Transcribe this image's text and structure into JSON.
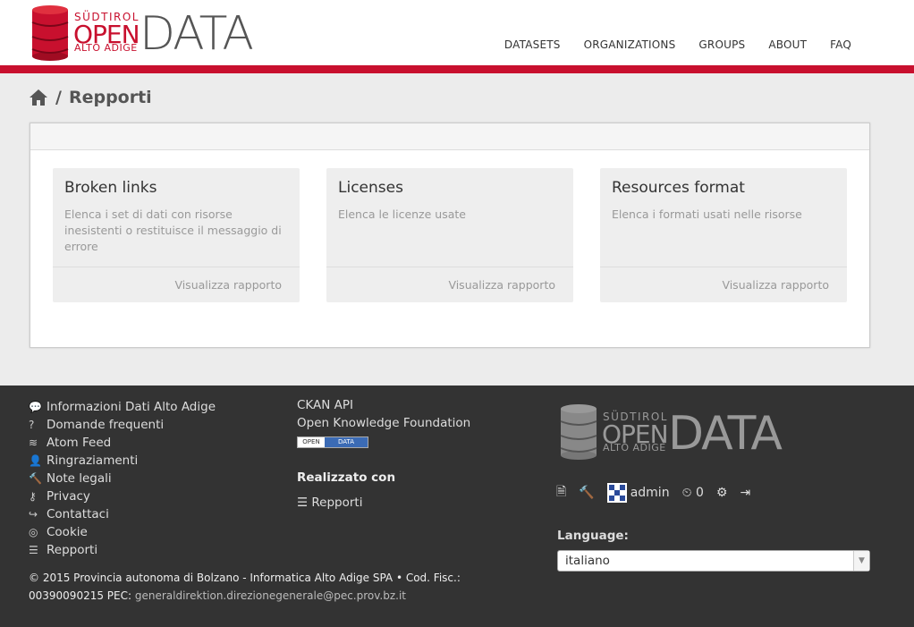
{
  "logo": {
    "sud": "SÜDTIROL",
    "open": "OPEN",
    "alto": "ALTO ADIGE",
    "data": "DATA"
  },
  "nav": [
    "DATASETS",
    "ORGANIZATIONS",
    "GROUPS",
    "ABOUT",
    "FAQ"
  ],
  "breadcrumb": {
    "separator": "/",
    "current": "Repporti"
  },
  "cards": [
    {
      "title": "Broken links",
      "desc": "Elenca i set di dati con risorse inesistenti o restituisce il messaggio di errore",
      "link": "Visualizza rapporto"
    },
    {
      "title": "Licenses",
      "desc": "Elenca le licenze usate",
      "link": "Visualizza rapporto"
    },
    {
      "title": "Resources format",
      "desc": "Elenca i formati usati nelle risorse",
      "link": "Visualizza rapporto"
    }
  ],
  "footer": {
    "links": [
      {
        "icon": "comment-icon",
        "glyph": "💬",
        "label": "Informazioni Dati Alto Adige"
      },
      {
        "icon": "question-icon",
        "glyph": "?",
        "label": "Domande frequenti"
      },
      {
        "icon": "rss-icon",
        "glyph": "≋",
        "label": "Atom Feed"
      },
      {
        "icon": "user-icon",
        "glyph": "👤",
        "label": "Ringraziamenti"
      },
      {
        "icon": "gavel-icon",
        "glyph": "🔨",
        "label": "Note legali"
      },
      {
        "icon": "key-icon",
        "glyph": "⚷",
        "label": "Privacy"
      },
      {
        "icon": "share-icon",
        "glyph": "↪",
        "label": "Contattaci"
      },
      {
        "icon": "cookie-icon",
        "glyph": "◎",
        "label": "Cookie"
      },
      {
        "icon": "list-icon",
        "glyph": "☰",
        "label": "Repporti"
      }
    ],
    "api": "CKAN API",
    "okf": "Open Knowledge Foundation",
    "badge": {
      "left": "OPEN",
      "right": "DATA"
    },
    "made_with": "Realizzato con",
    "reports_link": "Repporti",
    "user": {
      "name": "admin",
      "count": "0"
    },
    "language_label": "Language:",
    "language_value": "italiano",
    "copyright": "© 2015 Provincia autonoma di Bolzano - Informatica Alto Adige SPA • Cod. Fisc.: 00390090215 PEC:",
    "email": "generaldirektion.direzionegenerale@pec.prov.bz.it"
  },
  "colors": {
    "brand_red": "#c8102e",
    "footer_bg": "#333333"
  }
}
